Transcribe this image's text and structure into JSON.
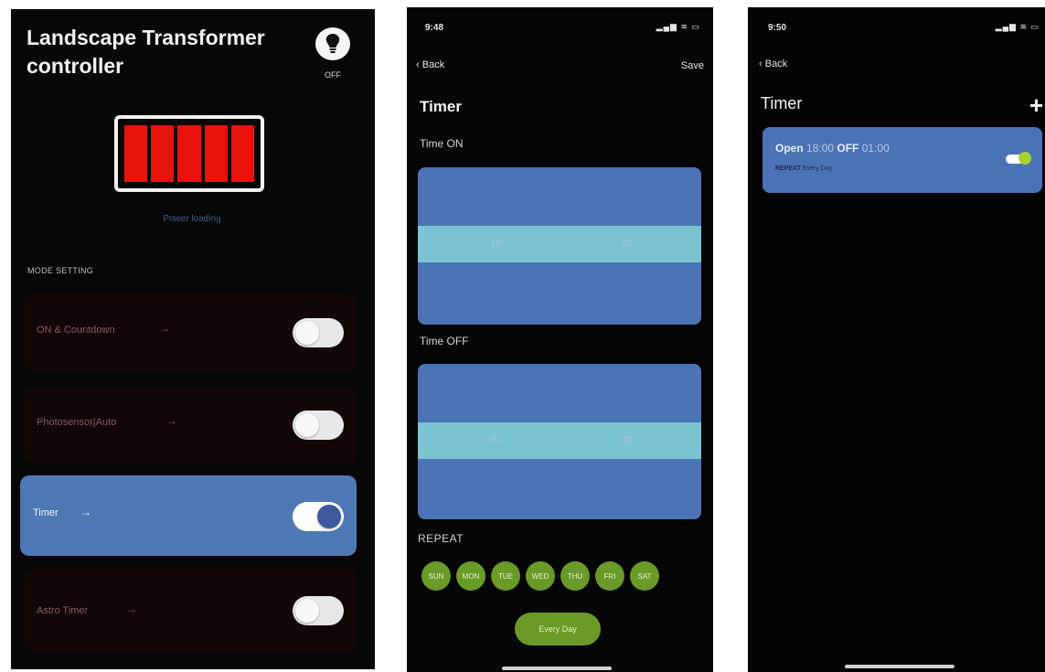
{
  "screen1": {
    "title": "Landscape Transformer controller",
    "bulb_label": "OFF",
    "battery": {
      "cells": 5,
      "color": "#e8140c"
    },
    "battery_status": "Power loading",
    "mode_section_title": "MODE SETTING",
    "modes": [
      {
        "label": "ON & Countdown",
        "arrow": "→",
        "enabled": false,
        "active": false
      },
      {
        "label": "Photosensor|Auto",
        "arrow": "→",
        "enabled": false,
        "active": false
      },
      {
        "label": "Timer",
        "arrow": "→",
        "enabled": true,
        "active": true
      },
      {
        "label": "Astro Timer",
        "arrow": "→",
        "enabled": false,
        "active": false
      }
    ]
  },
  "screen2": {
    "status_time": "9:48",
    "status_icons": "▂▄▆ ≋ ▭",
    "back_label": "Back",
    "save_label": "Save",
    "title": "Timer",
    "time_on_label": "Time ON",
    "time_on": {
      "hour": "18",
      "minute": "00"
    },
    "time_off_label": "Time OFF",
    "time_off": {
      "hour": "01",
      "minute": "00"
    },
    "repeat_label": "REPEAT",
    "days": [
      "SUN",
      "MON",
      "TUE",
      "WED",
      "THU",
      "FRI",
      "SAT"
    ],
    "every_day_label": "Every Day"
  },
  "screen3": {
    "status_time": "9:50",
    "status_icons": "▂▄▆ ≋ ▭",
    "back_label": "Back",
    "title": "Timer",
    "add_label": "+",
    "timer_item": {
      "open_label": "Open",
      "open_time": "18:00",
      "off_label": "OFF",
      "off_time": "01:00",
      "repeat_label": "REPEAT",
      "repeat_value": "Every Day",
      "enabled": true
    }
  },
  "colors": {
    "accent_blue": "#4f79b5",
    "picker_band": "#7bc2d2",
    "day_green": "#6a9a28",
    "toggle_green": "#a8d232"
  }
}
